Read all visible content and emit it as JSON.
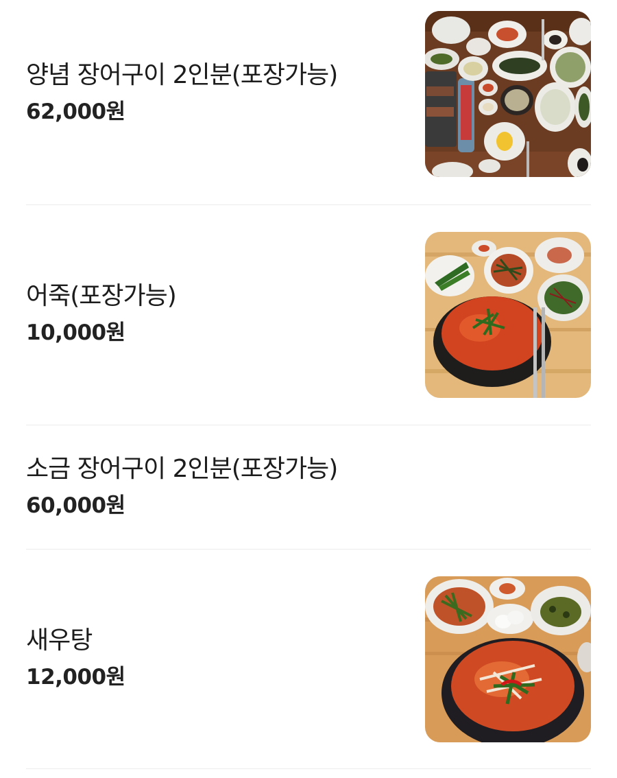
{
  "menu": {
    "items": [
      {
        "name": "양념 장어구이 2인분(포장가능)",
        "price": "62,000원",
        "image": "grilled-eel-table-photo"
      },
      {
        "name": "어죽(포장가능)",
        "price": "10,000원",
        "image": "fish-porridge-stew-photo"
      },
      {
        "name": "소금 장어구이 2인분(포장가능)",
        "price": "60,000원",
        "image": null
      },
      {
        "name": "새우탕",
        "price": "12,000원",
        "image": "shrimp-stew-photo"
      }
    ]
  }
}
